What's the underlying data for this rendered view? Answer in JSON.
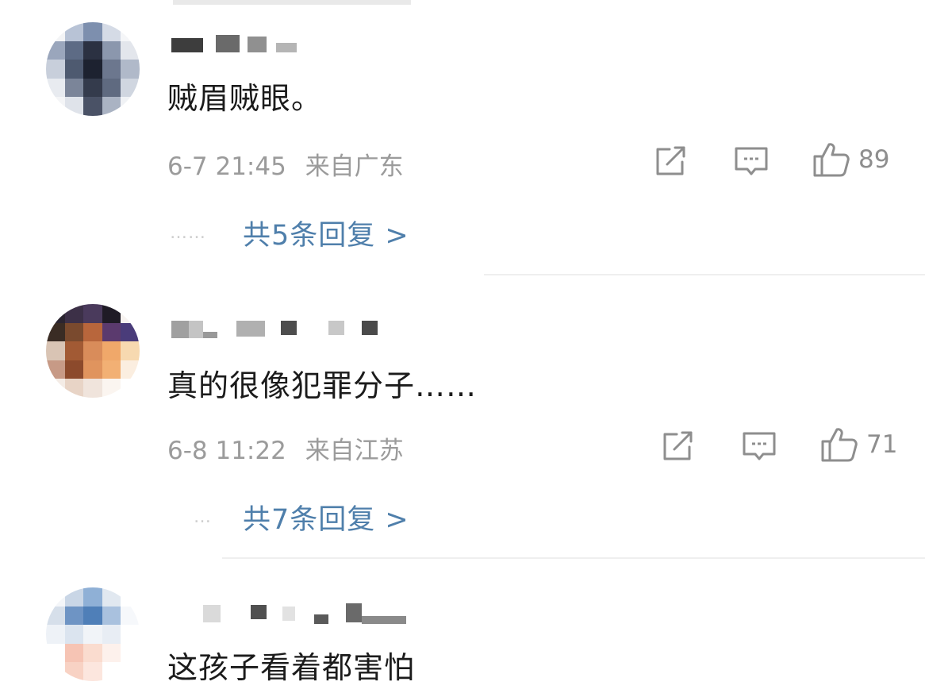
{
  "comments": [
    {
      "text": "贼眉贼眼。",
      "date": "6-7 21:45",
      "location": "来自广东",
      "likes": "89",
      "dots": "……",
      "replies_label": "共5条回复 >"
    },
    {
      "text": "真的很像犯罪分子……",
      "date": "6-8 11:22",
      "location": "来自江苏",
      "likes": "71",
      "dots": "…",
      "replies_label": "共7条回复 >"
    },
    {
      "text": "这孩子看着都害怕"
    }
  ],
  "colors": {
    "text": "#1b1b1b",
    "meta": "#9b9b9b",
    "link": "#4f7fab",
    "icon": "#8e8e8e",
    "divider": "#efefef"
  },
  "icons": {
    "share": "share-icon",
    "comment": "comment-icon",
    "like": "like-icon"
  }
}
